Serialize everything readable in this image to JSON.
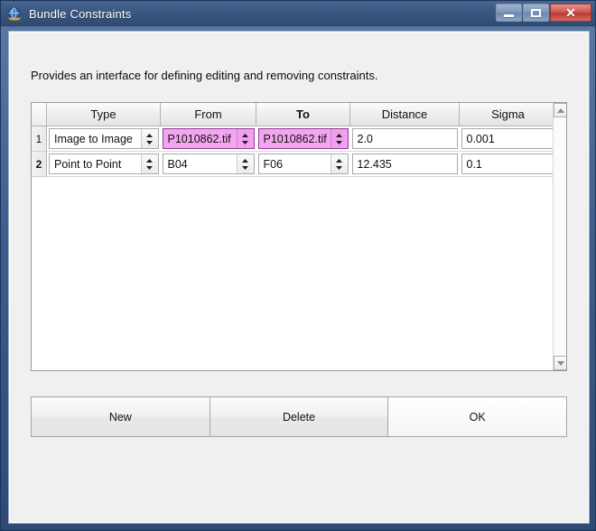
{
  "window": {
    "title": "Bundle Constraints",
    "icon": "globe-icon",
    "controls": {
      "minimize": "minimize-icon",
      "maximize": "restore-icon",
      "close": "✕"
    }
  },
  "description": "Provides an interface for defining editing and removing constraints.",
  "table": {
    "columns": [
      {
        "label": "Type",
        "sorted": false
      },
      {
        "label": "From",
        "sorted": false
      },
      {
        "label": "To",
        "sorted": true
      },
      {
        "label": "Distance",
        "sorted": false
      },
      {
        "label": "Sigma",
        "sorted": false
      }
    ],
    "rows": [
      {
        "number": "1",
        "number_bold": false,
        "type": "Image to Image",
        "from": "P1010862.tif",
        "to": "P1010862.tif",
        "distance": "2.0",
        "sigma": "0.001",
        "highlight": true
      },
      {
        "number": "2",
        "number_bold": true,
        "type": "Point to Point",
        "from": "B04",
        "to": "F06",
        "distance": "12.435",
        "sigma": "0.1",
        "highlight": false
      }
    ]
  },
  "scrollbar": {
    "up_arrow": "scroll-up-icon",
    "down_arrow": "scroll-down-icon"
  },
  "buttons": {
    "new": "New",
    "delete": "Delete",
    "ok": "OK"
  },
  "colors": {
    "titlebar": "#32507a",
    "client_bg": "#f0f0f0",
    "highlight_pink": "#f3a6ef",
    "highlight_border": "#8e3f96",
    "close_red": "#bb3a33"
  }
}
